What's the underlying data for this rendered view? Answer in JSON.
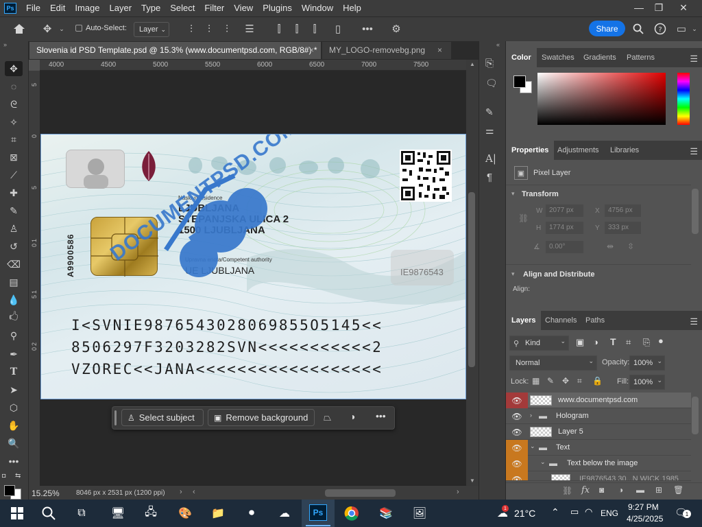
{
  "app": {
    "logo": "Ps"
  },
  "menu": [
    "File",
    "Edit",
    "Image",
    "Layer",
    "Type",
    "Select",
    "Filter",
    "View",
    "Plugins",
    "Window",
    "Help"
  ],
  "options_bar": {
    "auto_select_label": "Auto-Select:",
    "auto_select_value": "Layer",
    "share_label": "Share"
  },
  "tabs": [
    {
      "label": "Slovenia id PSD Template.psd @ 15.3% (www.documentpsd.com, RGB/8#) *",
      "close": "×"
    },
    {
      "label": "MY_LOGO-removebg.png",
      "close": "×"
    }
  ],
  "ruler": {
    "h_ticks": [
      "4000",
      "4500",
      "5000",
      "5500",
      "6000",
      "6500",
      "7000",
      "7500"
    ],
    "v_ticks": [
      "5",
      "0",
      "5",
      "1",
      "0",
      "1",
      "5",
      "2",
      "0"
    ]
  },
  "document": {
    "residence_label": "Naslov/Residence",
    "address_line1": "LJUBLJANA",
    "address_line2": "STEPANJSKA ULICA 2",
    "address_line3": "1500 LJUBLJANA",
    "authority_label": "Upravna enota/Competent authority",
    "authority_value": "UE LJUBLJANA",
    "side_number": "A9900586",
    "ghost_number": "IE9876543",
    "mrz_line1": "I<SVNIE9876543028069855O5145<<",
    "mrz_line2": "8506297F3203282SVN<<<<<<<<<<<2",
    "mrz_line3": "VZOREC<<JANA<<<<<<<<<<<<<<<<<<",
    "watermark_text": "DOCUMENTPSD.COM"
  },
  "context_bar": {
    "select_subject": "Select subject",
    "remove_background": "Remove background"
  },
  "status": {
    "zoom": "15.25%",
    "doc_info": "8046 px x 2531 px (1200 ppi)"
  },
  "color_panel": {
    "tabs": [
      "Color",
      "Swatches",
      "Gradients",
      "Patterns"
    ]
  },
  "properties_panel": {
    "tabs": [
      "Properties",
      "Adjustments",
      "Libraries"
    ],
    "layer_type": "Pixel Layer",
    "transform_title": "Transform",
    "w_label": "W",
    "w_value": "2077 px",
    "h_label": "H",
    "h_value": "1774 px",
    "x_label": "X",
    "x_value": "4756 px",
    "y_label": "Y",
    "y_value": "333 px",
    "angle_value": "0.00°",
    "align_title": "Align and Distribute",
    "align_label": "Align:"
  },
  "layers_panel": {
    "tabs": [
      "Layers",
      "Channels",
      "Paths"
    ],
    "kind_label": "Kind",
    "blend_mode": "Normal",
    "opacity_label": "Opacity:",
    "opacity_value": "100%",
    "lock_label": "Lock:",
    "fill_label": "Fill:",
    "fill_value": "100%",
    "layers": [
      {
        "name": "www.documentpsd.com"
      },
      {
        "name": "Hologram"
      },
      {
        "name": "Layer 5"
      },
      {
        "name": "Text"
      },
      {
        "name": "Text below the image"
      },
      {
        "name": "IE9876543 30...N WICK 1985"
      }
    ]
  },
  "taskbar": {
    "weather_temp": "21°C",
    "lang": "ENG",
    "time": "9:27 PM",
    "date": "4/25/2025",
    "notification_count": "1",
    "weather_badge": "1"
  }
}
